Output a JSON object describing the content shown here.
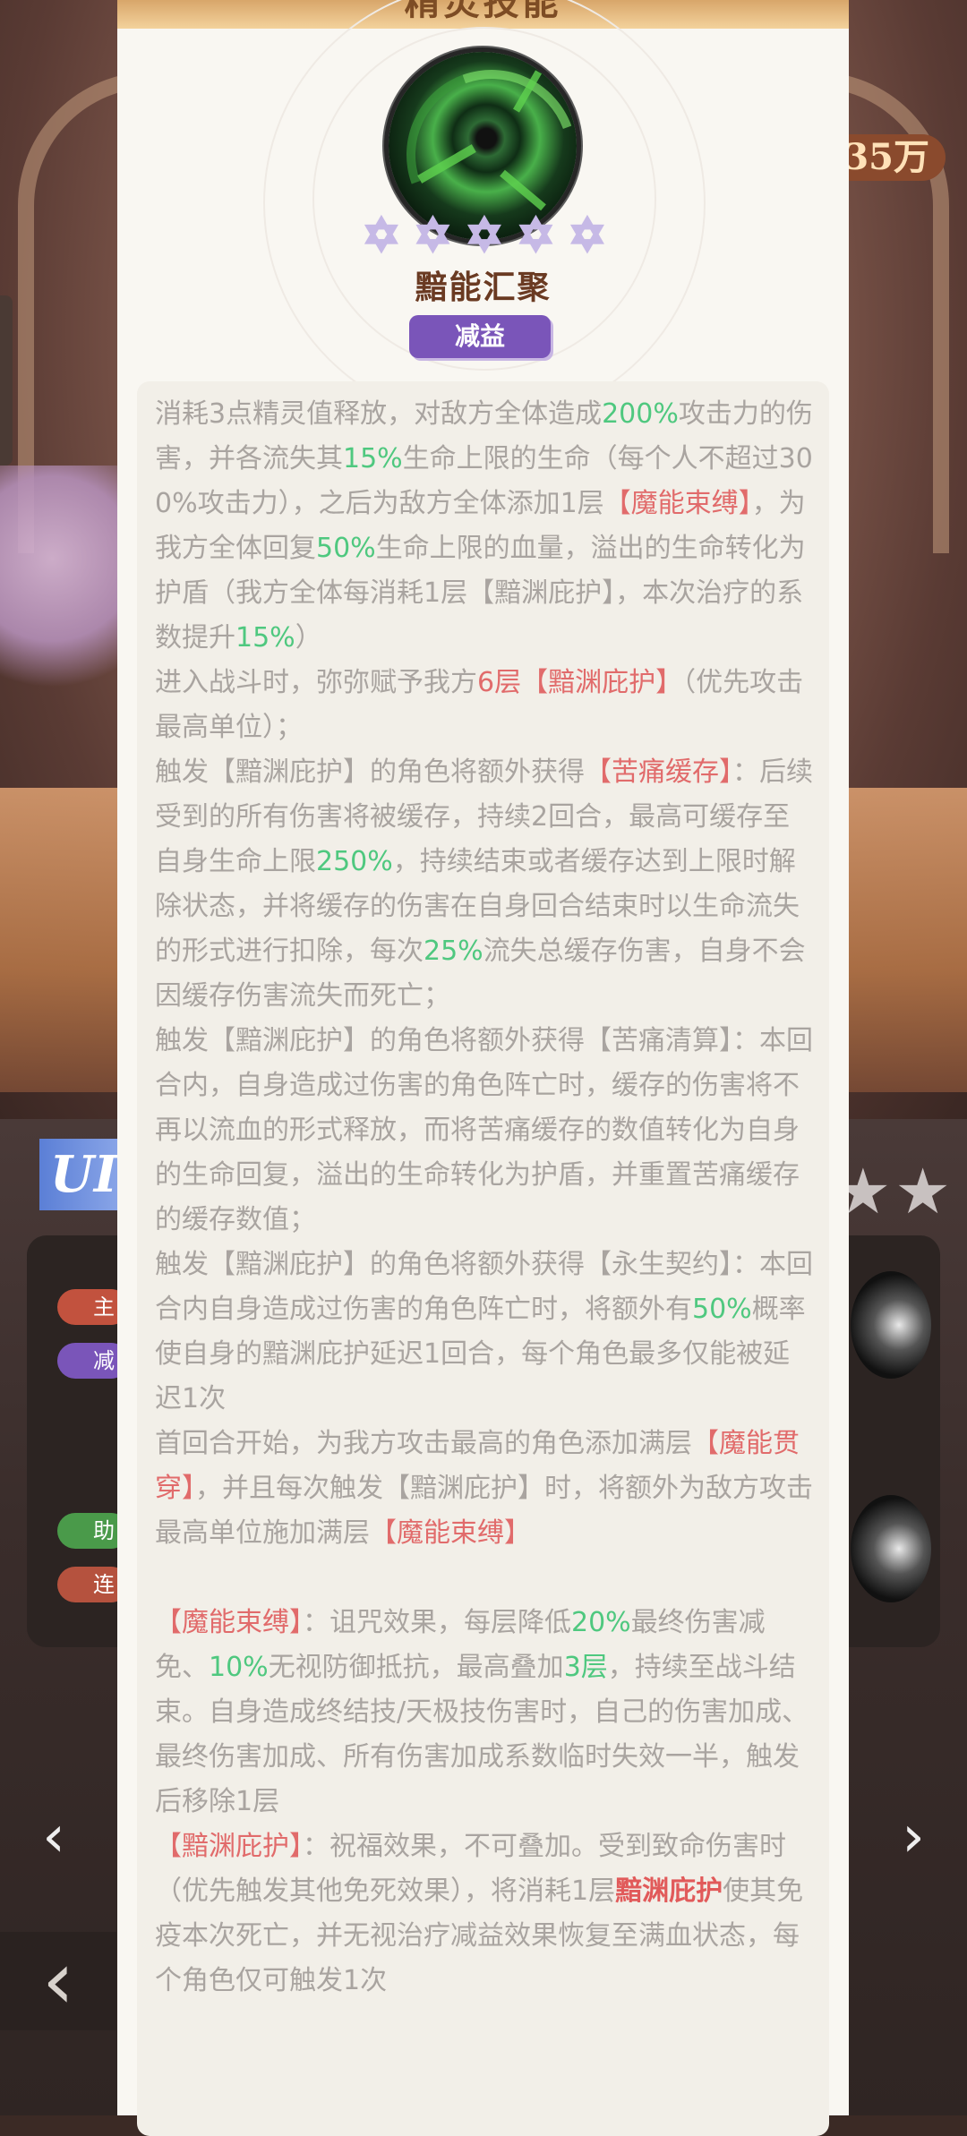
{
  "background": {
    "coins_label": "35万",
    "ur_label": "UI",
    "nav_prev": "‹",
    "nav_next": "›",
    "back": "‹",
    "pill_1": "主",
    "pill_2": "减",
    "pill_3": "助",
    "pill_4": "连"
  },
  "modal": {
    "header_title": "精灵技能",
    "skill_name": "黯能汇聚",
    "skill_tag": "减益",
    "star_count": 5,
    "star_glyph": "✡",
    "colors": {
      "green": "#4fc87f",
      "red": "#e16b6b",
      "tag_purple": "#7a55b9",
      "text_gray": "#a9a4a0"
    },
    "desc": [
      [
        {
          "t": "消耗3点精灵值释放，对敌方全体造成"
        },
        {
          "t": "200%",
          "c": "g"
        },
        {
          "t": "攻击力的伤害，并各流失其"
        },
        {
          "t": "15%",
          "c": "g"
        },
        {
          "t": "生命上限的生命（每个人不超过300%攻击力），之后为敌方全体添加1层"
        },
        {
          "t": "【魔能束缚】",
          "c": "r"
        },
        {
          "t": "，为我方全体回复"
        },
        {
          "t": "50%",
          "c": "g"
        },
        {
          "t": "生命上限的血量，溢出的生命转化为护盾（我方全体每消耗1层【黯渊庇护】，本次治疗的系数提升"
        },
        {
          "t": "15%",
          "c": "g"
        },
        {
          "t": "）"
        }
      ],
      [
        {
          "t": "进入战斗时，弥弥赋予我方"
        },
        {
          "t": "6层",
          "c": "r"
        },
        {
          "t": "【黯渊庇护】",
          "c": "r"
        },
        {
          "t": "（优先攻击最高单位）；"
        }
      ],
      [
        {
          "t": "触发【黯渊庇护】的角色将额外获得"
        },
        {
          "t": "【苦痛缓存】",
          "c": "r"
        },
        {
          "t": "：后续受到的所有伤害将被缓存，持续2回合，最高可缓存至自身生命上限"
        },
        {
          "t": "250%",
          "c": "g"
        },
        {
          "t": "，持续结束或者缓存达到上限时解除状态，并将缓存的伤害在自身回合结束时以生命流失的形式进行扣除，每次"
        },
        {
          "t": "25%",
          "c": "g"
        },
        {
          "t": "流失总缓存伤害，自身不会因缓存伤害流失而死亡；"
        }
      ],
      [
        {
          "t": "触发【黯渊庇护】的角色将额外获得【苦痛清算】：本回合内，自身造成过伤害的角色阵亡时，缓存的伤害将不再以流血的形式释放，而将苦痛缓存的数值转化为自身的生命回复，溢出的生命转化为护盾，并重置苦痛缓存的缓存数值；"
        }
      ],
      [
        {
          "t": "触发【黯渊庇护】的角色将额外获得【永生契约】：本回合内自身造成过伤害的角色阵亡时，将额外有"
        },
        {
          "t": "50%",
          "c": "g"
        },
        {
          "t": "概率使自身的黯渊庇护延迟1回合，每个角色最多仅能被延迟1次"
        }
      ],
      [
        {
          "t": "首回合开始，为我方攻击最高的角色添加满层"
        },
        {
          "t": "【魔能贯穿】",
          "c": "r"
        },
        {
          "t": "，并且每次触发【黯渊庇护】时，将额外为敌方攻击最高单位施加满层"
        },
        {
          "t": "【魔能束缚】",
          "c": "r"
        }
      ],
      [
        {
          "t": " "
        }
      ],
      [
        {
          "t": "【魔能束缚】",
          "c": "r"
        },
        {
          "t": "：诅咒效果，每层降低"
        },
        {
          "t": "20%",
          "c": "g"
        },
        {
          "t": "最终伤害减免、"
        },
        {
          "t": "10%",
          "c": "g"
        },
        {
          "t": "无视防御抵抗，最高叠加"
        },
        {
          "t": "3层",
          "c": "g"
        },
        {
          "t": "，持续至战斗结束。自身造成终结技/天极技伤害时，自己的伤害加成、最终伤害加成、所有伤害加成系数临时失效一半，触发后移除1层"
        }
      ],
      [
        {
          "t": "【黯渊庇护】",
          "c": "r"
        },
        {
          "t": "：祝福效果，不可叠加。受到致命伤害时（优先触发其他免死效果），将消耗1层"
        },
        {
          "t": "黯渊庇护",
          "c": "rr"
        },
        {
          "t": "使其免疫本次死亡，并无视治疗减益效果恢复至满血状态，每个角色仅可触发1次"
        }
      ]
    ]
  }
}
